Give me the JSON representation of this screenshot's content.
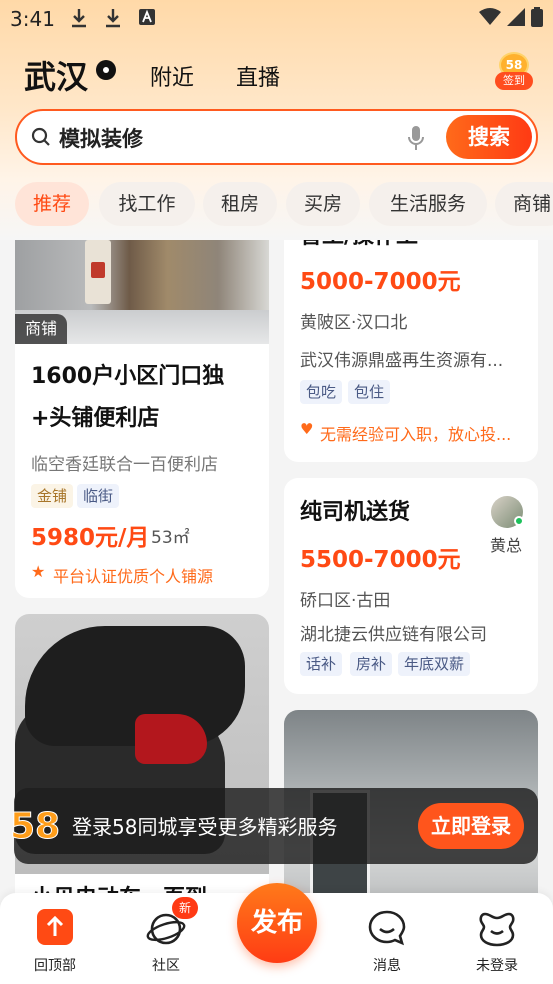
{
  "status_bar": {
    "time": "3:41",
    "icons": [
      "download-icon",
      "download-icon",
      "font-icon",
      "wifi-icon",
      "signal-icon",
      "battery-icon"
    ]
  },
  "header": {
    "city": "武汉",
    "nav": [
      "附近",
      "直播"
    ],
    "signin_badge": "58",
    "signin_label": "签到"
  },
  "search": {
    "query": "模拟装修",
    "button": "搜索"
  },
  "tabs": [
    {
      "label": "推荐",
      "active": true
    },
    {
      "label": "找工作"
    },
    {
      "label": "租房"
    },
    {
      "label": "买房"
    },
    {
      "label": "生活服务"
    },
    {
      "label": "商铺"
    }
  ],
  "feed": {
    "left": [
      {
        "type": "shop",
        "photo_tag": "商铺",
        "title_line1": "1600户小区门口独",
        "title_line2": "+头铺便利店",
        "subtitle": "临空香廷联合一百便利店",
        "tags": [
          "金铺",
          "临街"
        ],
        "price": "5980元/月",
        "area": "53㎡",
        "note": "平台认证优质个人铺源"
      },
      {
        "type": "scooter",
        "title_partial": "小贝电动车一页到"
      }
    ],
    "right": [
      {
        "type": "job",
        "title_partial": "普工/操作工",
        "salary": "5000-7000元",
        "location": "黄陂区·汉口北",
        "company": "武汉伟源鼎盛再生资源有...",
        "tags": [
          "包吃",
          "包住"
        ],
        "note": "无需经验可入职，放心投..."
      },
      {
        "type": "job",
        "title": "纯司机送货",
        "salary": "5500-7000元",
        "location": "硚口区·古田",
        "company": "湖北捷云供应链有限公司",
        "tags": [
          "话补",
          "房补",
          "年底双薪"
        ],
        "contact": "黄总"
      },
      {
        "type": "room"
      }
    ]
  },
  "login_banner": {
    "text": "登录58同城享受更多精彩服务",
    "button": "立即登录"
  },
  "bottom_nav": {
    "back_to_top": "回顶部",
    "community": "社区",
    "community_badge": "新",
    "publish": "发布",
    "messages": "消息",
    "login": "未登录"
  },
  "colors": {
    "accent": "#ff4a14",
    "tag_blue_bg": "#eef2fb",
    "tag_gold_bg": "#fbf4e6"
  }
}
